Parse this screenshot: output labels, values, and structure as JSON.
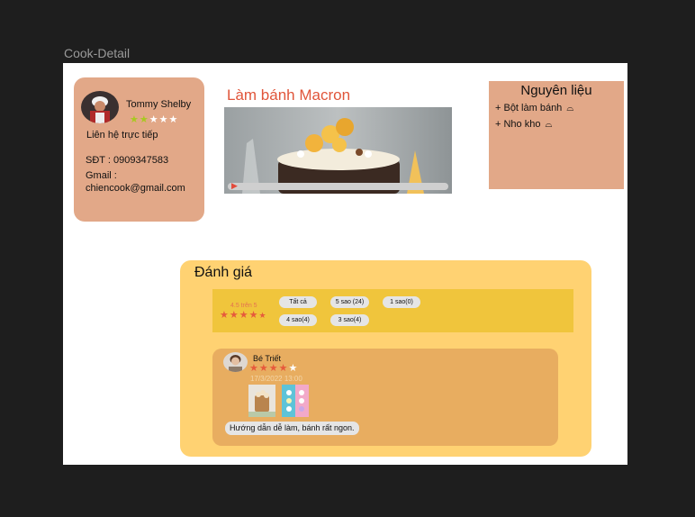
{
  "frame": {
    "title": "Cook-Detail"
  },
  "chef": {
    "name": "Tommy Shelby",
    "rating": 2,
    "rating_max": 5,
    "contact_heading": "Liên hệ trực tiếp",
    "phone": "SĐT : 0909347583",
    "gmail_label": "Gmail :",
    "gmail_value": "chiencook@gmail.com"
  },
  "recipe": {
    "title": "Làm bánh Macron",
    "video_progress": 0.02
  },
  "ingredients": {
    "title": "Nguyên liệu",
    "items": [
      {
        "label": "+ Bột làm bánh",
        "icon": "bowl-icon"
      },
      {
        "label": "+ Nho kho",
        "icon": "bowl-icon"
      }
    ]
  },
  "reviews": {
    "title": "Đánh giá",
    "summary": {
      "text": "4.5 trên 5",
      "stars": 4.5
    },
    "filters": [
      "Tất cả",
      "5 sao (24)",
      "1 sao(0)",
      "4 sao(4)",
      "3 sao(4)"
    ],
    "items": [
      {
        "name": "Bé Triết",
        "stars": 4,
        "date": "17/3/2022 13:00",
        "comment": "Hướng dẫn dễ làm, bánh rất ngon."
      }
    ]
  },
  "colors": {
    "accent_title": "#e0553a",
    "card_bg": "#e2a888",
    "reviews_bg": "#ffd272",
    "rating_bar_bg": "#f0c53c",
    "review_card_bg": "#e8ad60"
  }
}
